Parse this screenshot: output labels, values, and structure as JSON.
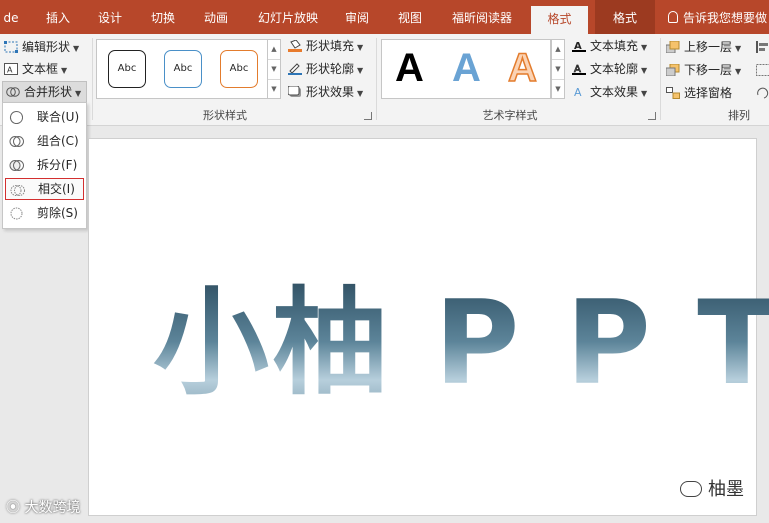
{
  "tabs": [
    {
      "label": "de"
    },
    {
      "label": "插入"
    },
    {
      "label": "设计"
    },
    {
      "label": "切换"
    },
    {
      "label": "动画"
    },
    {
      "label": "幻灯片放映"
    },
    {
      "label": "审阅"
    },
    {
      "label": "视图"
    },
    {
      "label": "福昕阅读器"
    },
    {
      "label": "格式"
    },
    {
      "label": "格式"
    }
  ],
  "tell_me": "告诉我您想要做",
  "insert_shapes": {
    "edit_shape": "编辑形状",
    "text_box": "文本框",
    "merge_shapes": "合并形状"
  },
  "merge_menu": {
    "items": [
      {
        "label": "联合(U)"
      },
      {
        "label": "组合(C)"
      },
      {
        "label": "拆分(F)"
      },
      {
        "label": "相交(I)"
      },
      {
        "label": "剪除(S)"
      }
    ],
    "selected": "相交(I)"
  },
  "shape_styles": {
    "group_label": "形状样式",
    "thumb_text": "Abc",
    "fill": "形状填充",
    "outline": "形状轮廓",
    "effects": "形状效果"
  },
  "wordart_styles": {
    "group_label": "艺术字样式",
    "sample": "A",
    "text_fill": "文本填充",
    "text_outline": "文本轮廓",
    "text_effects": "文本效果"
  },
  "arrange": {
    "group_label": "排列",
    "bring_forward": "上移一层",
    "send_backward": "下移一层",
    "selection_pane": "选择窗格"
  },
  "slide": {
    "wordart_text": "小柚 P P T",
    "watermark_right": "柚墨",
    "watermark_left": "大数跨境"
  },
  "colors": {
    "accent": "#b7472a",
    "selection_border": "#d32f2f"
  }
}
